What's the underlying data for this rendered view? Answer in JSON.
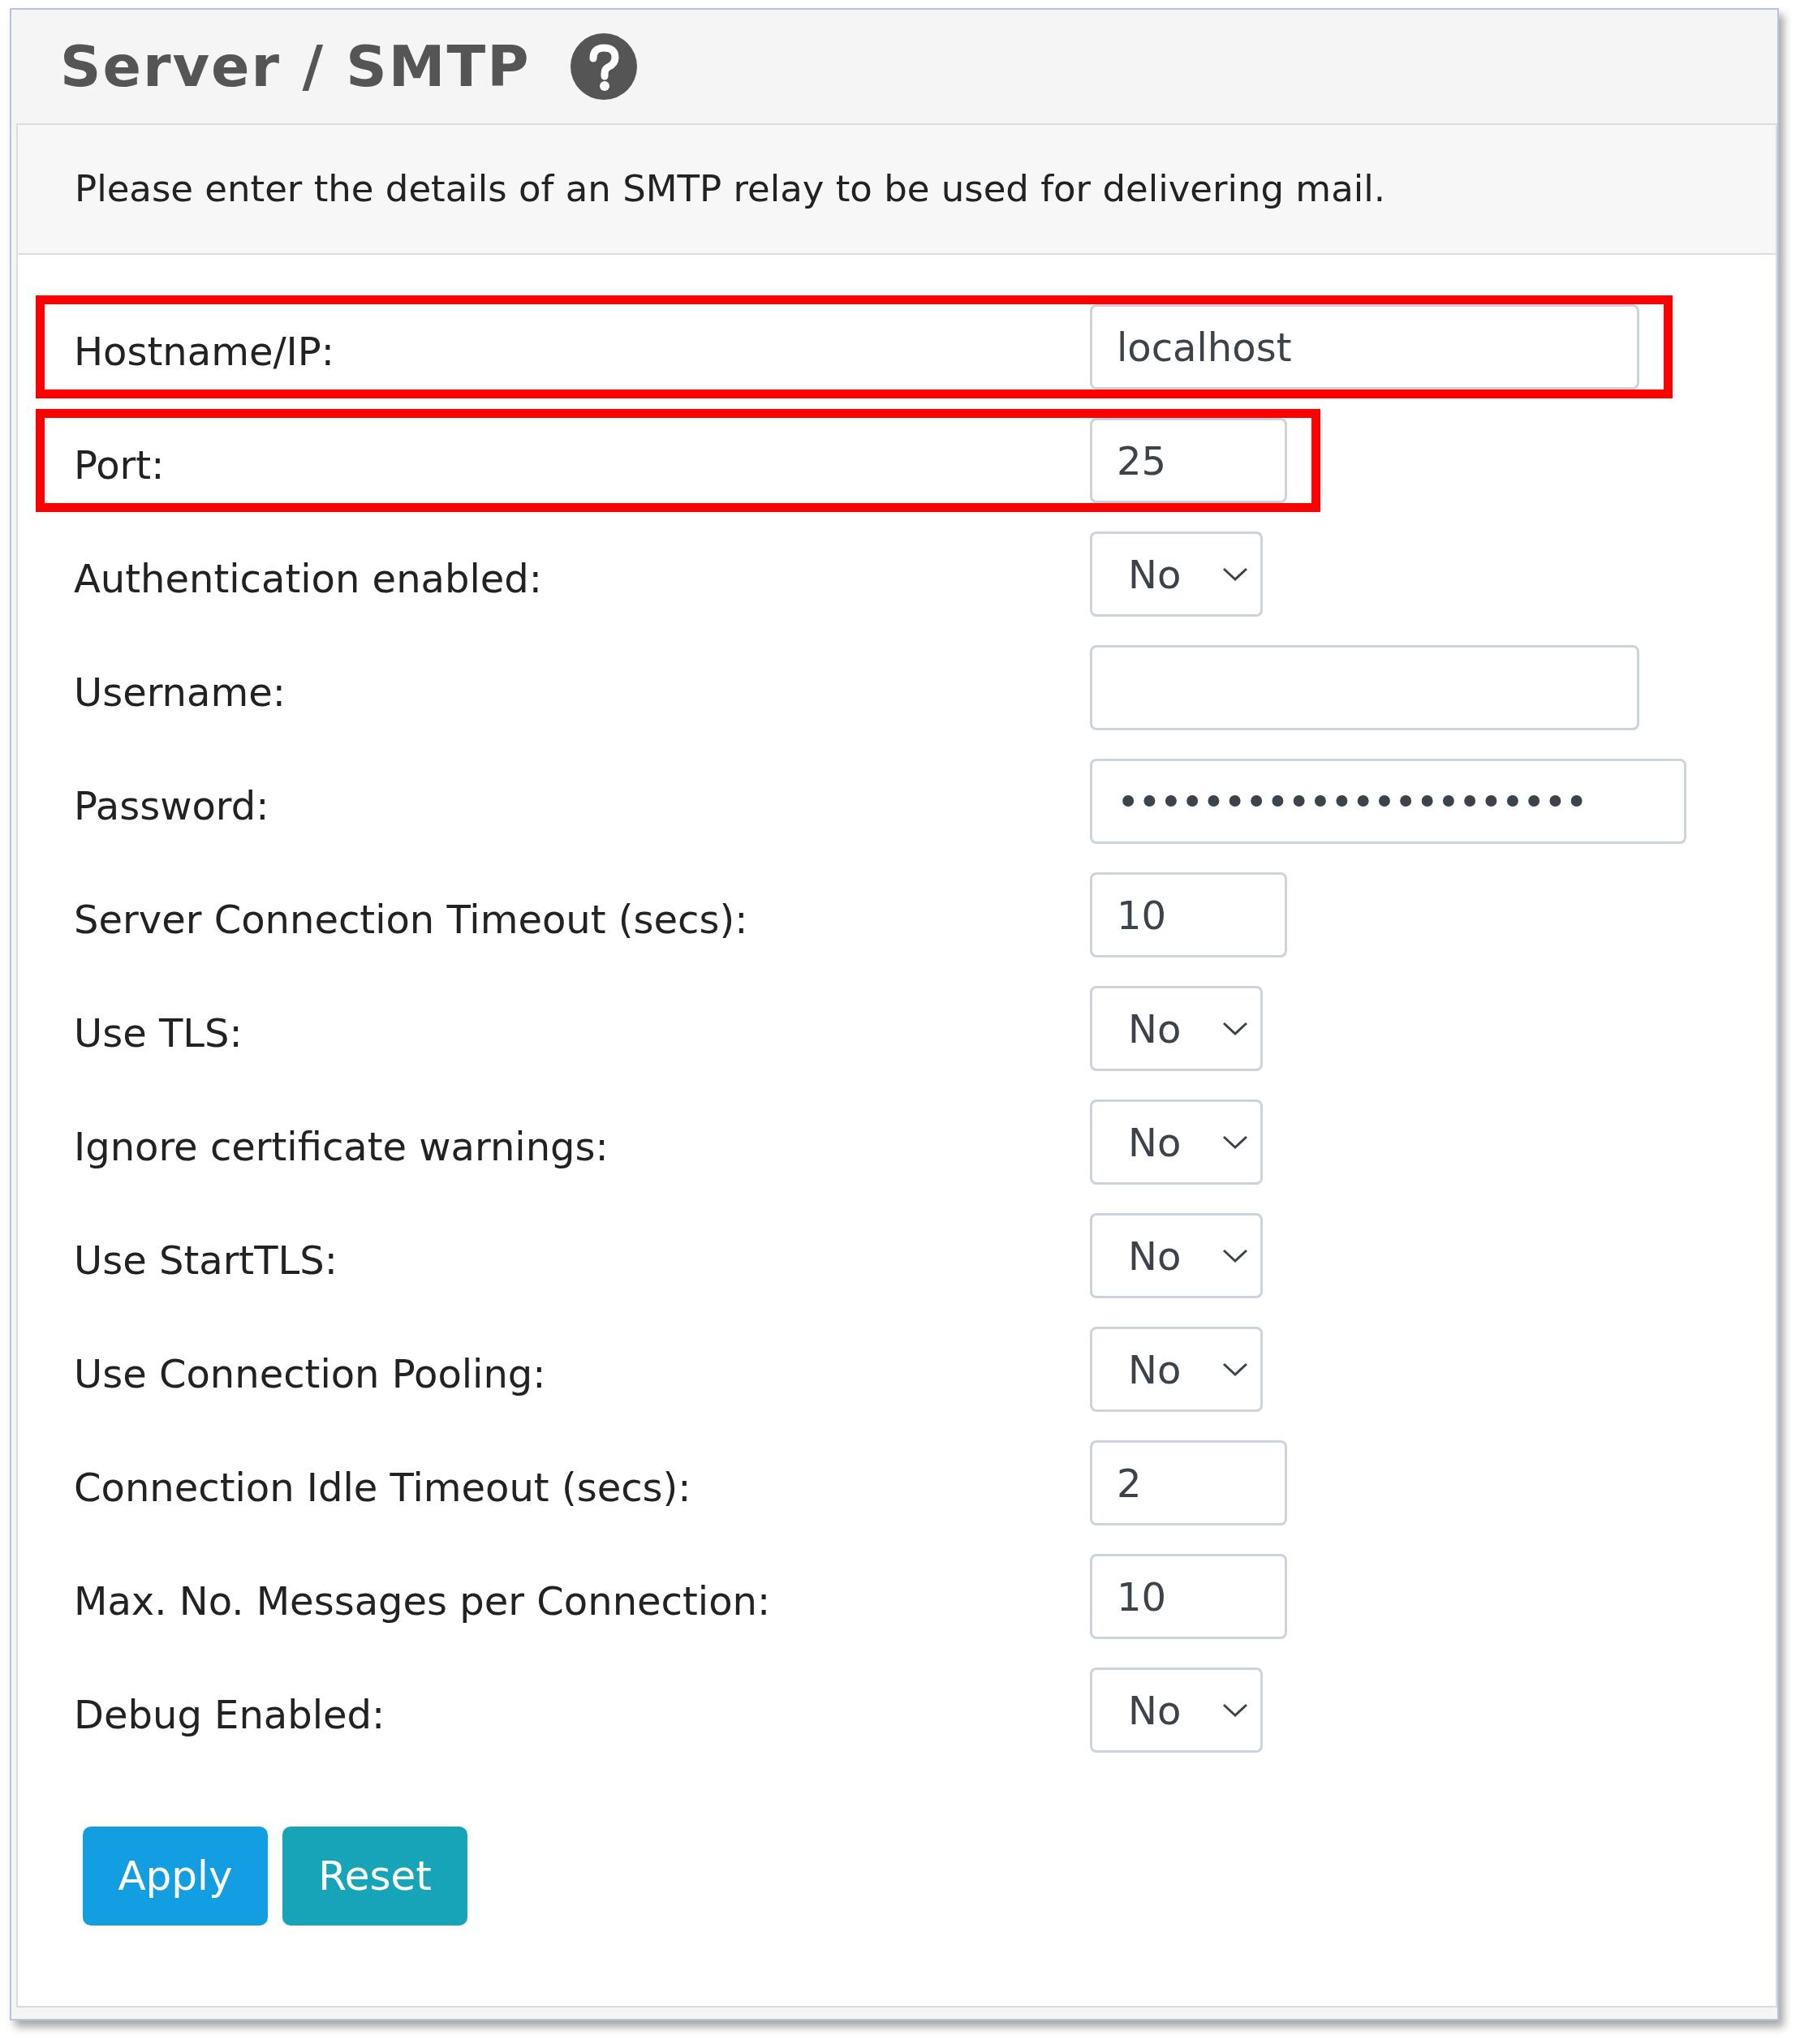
{
  "title": "Server / SMTP",
  "description": "Please enter the details of an SMTP relay to be used for delivering mail.",
  "fields": [
    {
      "label": "Hostname/IP:",
      "kind": "text",
      "value": "localhost",
      "highlighted": true
    },
    {
      "label": "Port:",
      "kind": "number",
      "value": "25",
      "highlighted": true
    },
    {
      "label": "Authentication enabled:",
      "kind": "select",
      "value": "No",
      "highlighted": false
    },
    {
      "label": "Username:",
      "kind": "text",
      "highlighted": false
    },
    {
      "label": "Password:",
      "kind": "password",
      "value": "••••••••••••••••••••••",
      "highlighted": false
    },
    {
      "label": "Server Connection Timeout (secs):",
      "kind": "number",
      "value": "10",
      "highlighted": false
    },
    {
      "label": "Use TLS:",
      "kind": "select",
      "value": "No",
      "highlighted": false
    },
    {
      "label": "Ignore certificate warnings:",
      "kind": "select",
      "value": "No",
      "highlighted": false
    },
    {
      "label": "Use StartTLS:",
      "kind": "select",
      "value": "No",
      "highlighted": false
    },
    {
      "label": "Use Connection Pooling:",
      "kind": "select",
      "value": "No",
      "highlighted": false
    },
    {
      "label": "Connection Idle Timeout (secs):",
      "kind": "number",
      "value": "2",
      "highlighted": false
    },
    {
      "label": "Max. No. Messages per Connection:",
      "kind": "number",
      "value": "10",
      "highlighted": false
    },
    {
      "label": "Debug Enabled:",
      "kind": "select",
      "value": "No",
      "highlighted": false
    }
  ],
  "buttons": [
    {
      "label": "Apply",
      "kind": "primary"
    },
    {
      "label": "Reset",
      "kind": "secondary"
    }
  ]
}
